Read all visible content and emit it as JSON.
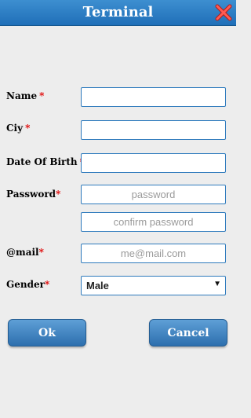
{
  "window": {
    "title": "Terminal"
  },
  "form": {
    "name": {
      "label": "Name",
      "required": "*",
      "value": ""
    },
    "city": {
      "label": "Ciy",
      "required": "*",
      "value": ""
    },
    "dob": {
      "label": "Date Of Birth",
      "required": "*",
      "value": ""
    },
    "password": {
      "label": "Password",
      "required": "*",
      "placeholder": "password",
      "confirm_placeholder": "confirm password"
    },
    "email": {
      "label": "@mail",
      "required": "*",
      "placeholder": "me@mail.com"
    },
    "gender": {
      "label": "Gender",
      "required": "*",
      "selected": "Male"
    }
  },
  "buttons": {
    "ok": "Ok",
    "cancel": "Cancel"
  },
  "colors": {
    "title_bar": "#2a7fc6",
    "field_border": "#2f7bbd",
    "required": "#e00000",
    "close_icon": "#e0302c"
  },
  "icons": {
    "close": "close-icon",
    "dropdown": "chevron-down-icon"
  }
}
